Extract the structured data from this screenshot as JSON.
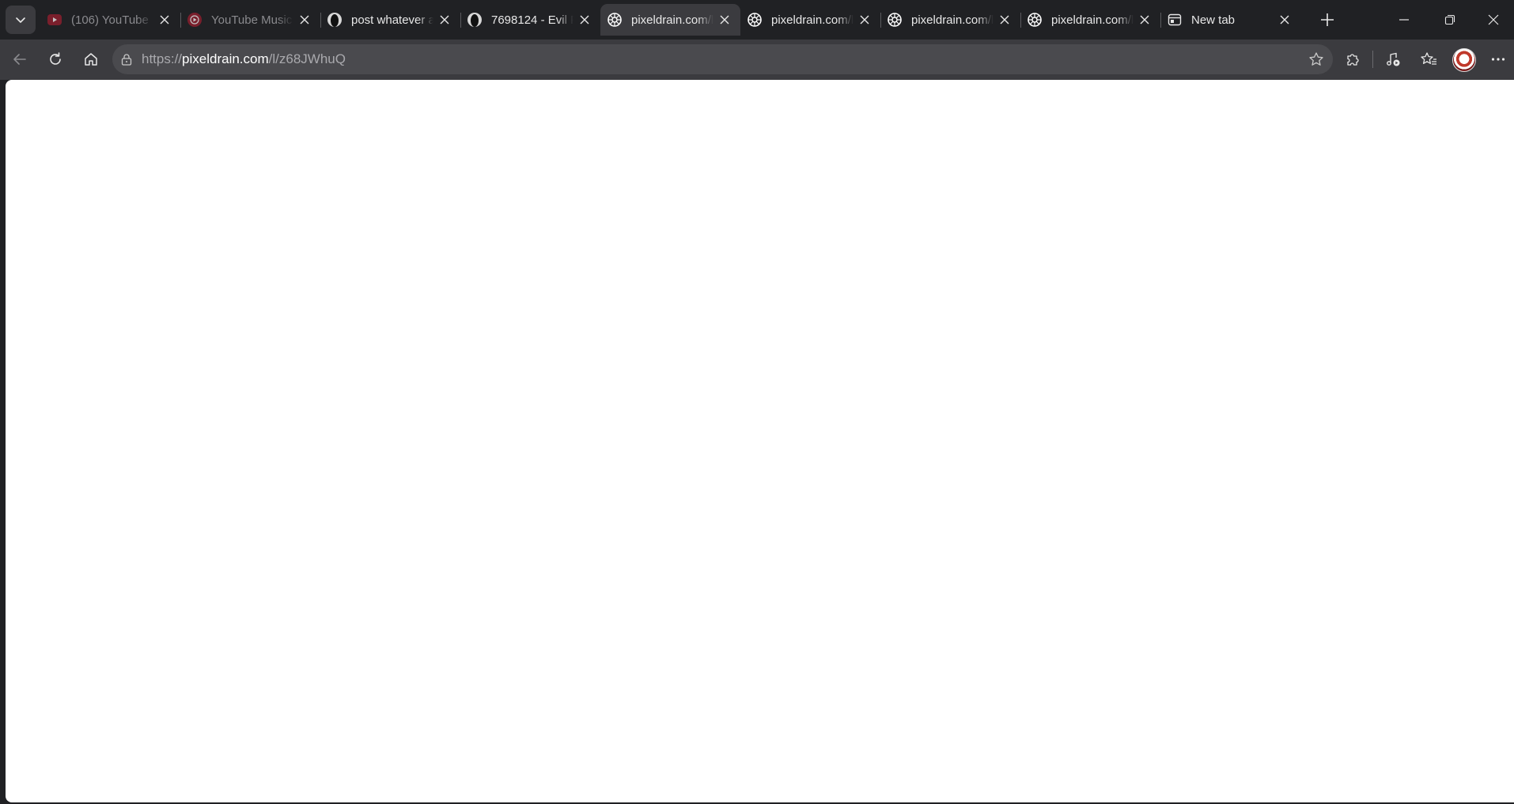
{
  "browser": {
    "tab_menu_icon": "chevron-down-icon",
    "tabs": [
      {
        "title": "(106) YouTube",
        "favicon": "youtube-icon",
        "dim": true,
        "active": false
      },
      {
        "title": "YouTube Music",
        "favicon": "youtube-music-icon",
        "dim": true,
        "active": false
      },
      {
        "title": "post whatever a",
        "favicon": "avatar-silhouette-icon",
        "dim": false,
        "active": false
      },
      {
        "title": "7698124 - Evil F",
        "favicon": "avatar-silhouette-icon",
        "dim": false,
        "active": false
      },
      {
        "title": "pixeldrain.com/l",
        "favicon": "pixeldrain-icon",
        "dim": false,
        "active": true
      },
      {
        "title": "pixeldrain.com/l",
        "favicon": "pixeldrain-icon",
        "dim": false,
        "active": false
      },
      {
        "title": "pixeldrain.com/l",
        "favicon": "pixeldrain-icon",
        "dim": false,
        "active": false
      },
      {
        "title": "pixeldrain.com/l",
        "favicon": "pixeldrain-icon",
        "dim": false,
        "active": false
      },
      {
        "title": "New tab",
        "favicon": "new-tab-page-icon",
        "dim": false,
        "active": false
      }
    ],
    "address_bar": {
      "scheme": "https://",
      "host": "pixeldrain.com",
      "path": "/l/z68JWhuQ"
    },
    "colors": {
      "tabstrip_bg": "#202124",
      "toolbar_bg": "#3b3b3f",
      "omnibox_bg": "#4a4a4e",
      "youtube_red": "#e0243a",
      "content_bg": "#ffffff"
    }
  }
}
